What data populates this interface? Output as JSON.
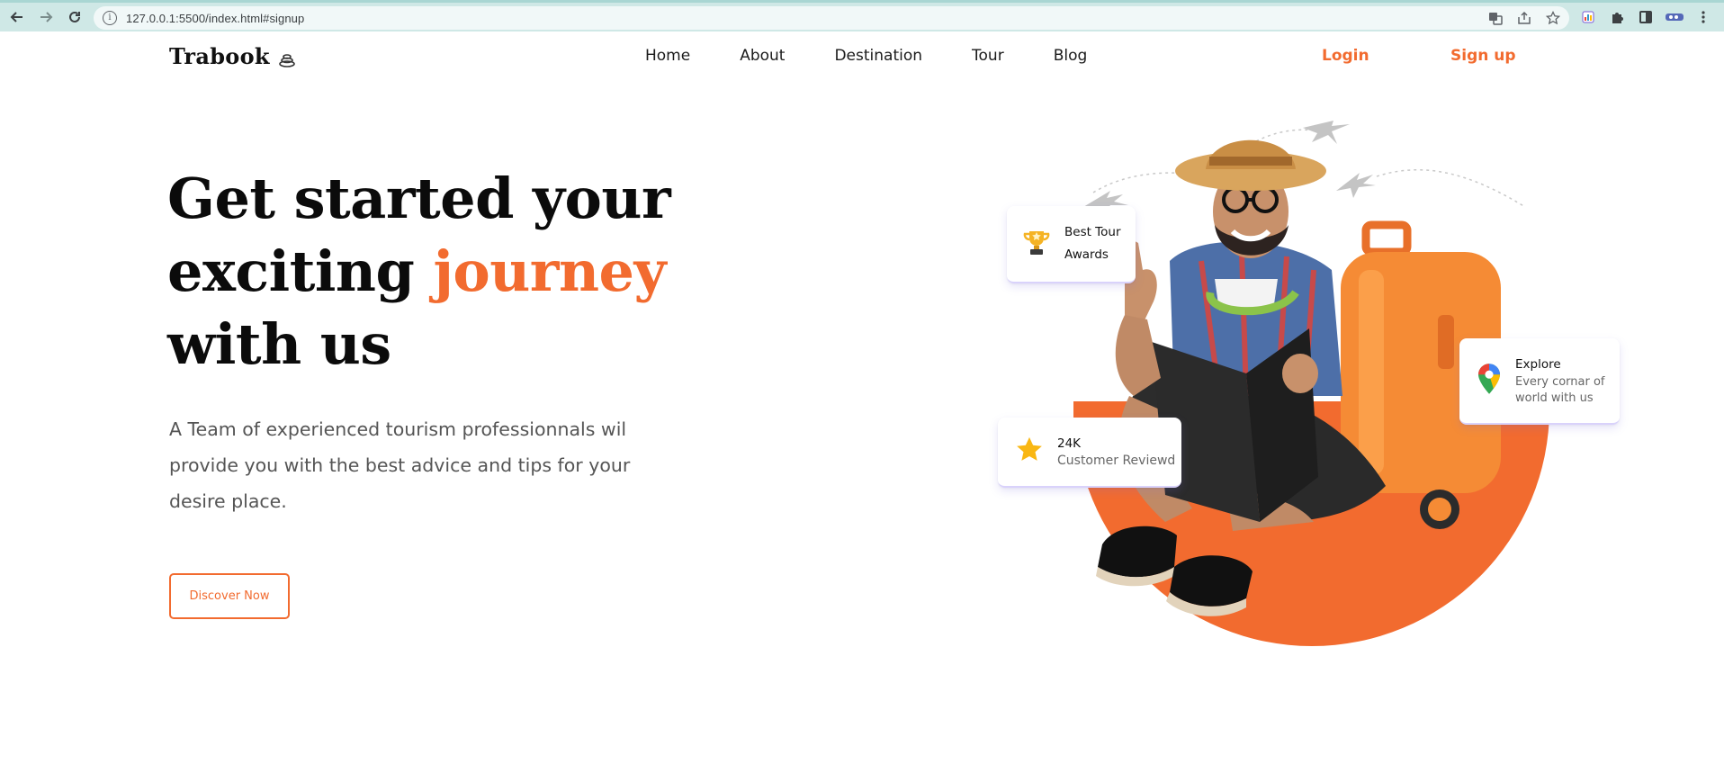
{
  "browser": {
    "url": "127.0.0.1:5500/index.html#signup",
    "icons": [
      "back-icon",
      "forward-icon",
      "reload-icon",
      "info-icon",
      "translate-icon",
      "share-icon",
      "star-icon",
      "extension-icon",
      "puzzle-icon",
      "sidepanel-icon",
      "profile-icon",
      "menu-icon"
    ]
  },
  "nav": {
    "logo": "Trabook",
    "links": [
      "Home",
      "About",
      "Destination",
      "Tour",
      "Blog"
    ],
    "login": "Login",
    "signup": "Sign up",
    "accent_color": "#f26b2f"
  },
  "hero": {
    "title_line1": "Get started your",
    "title_line2_prefix": "exciting",
    "title_line2_accent": "journey",
    "title_line3": "with us",
    "description": "A Team of experienced tourism professionnals wil provide you with the best advice and tips for your desire place.",
    "cta": "Discover Now"
  },
  "cards": {
    "award": {
      "title_line1": "Best Tour",
      "title_line2": "Awards",
      "icon": "trophy-icon"
    },
    "review": {
      "count": "24K",
      "label": "Customer Reviewd",
      "icon": "star-icon"
    },
    "explore": {
      "title": "Explore",
      "subtitle_line1": "Every cornar of",
      "subtitle_line2": "world with us",
      "icon": "map-pin-icon"
    }
  }
}
